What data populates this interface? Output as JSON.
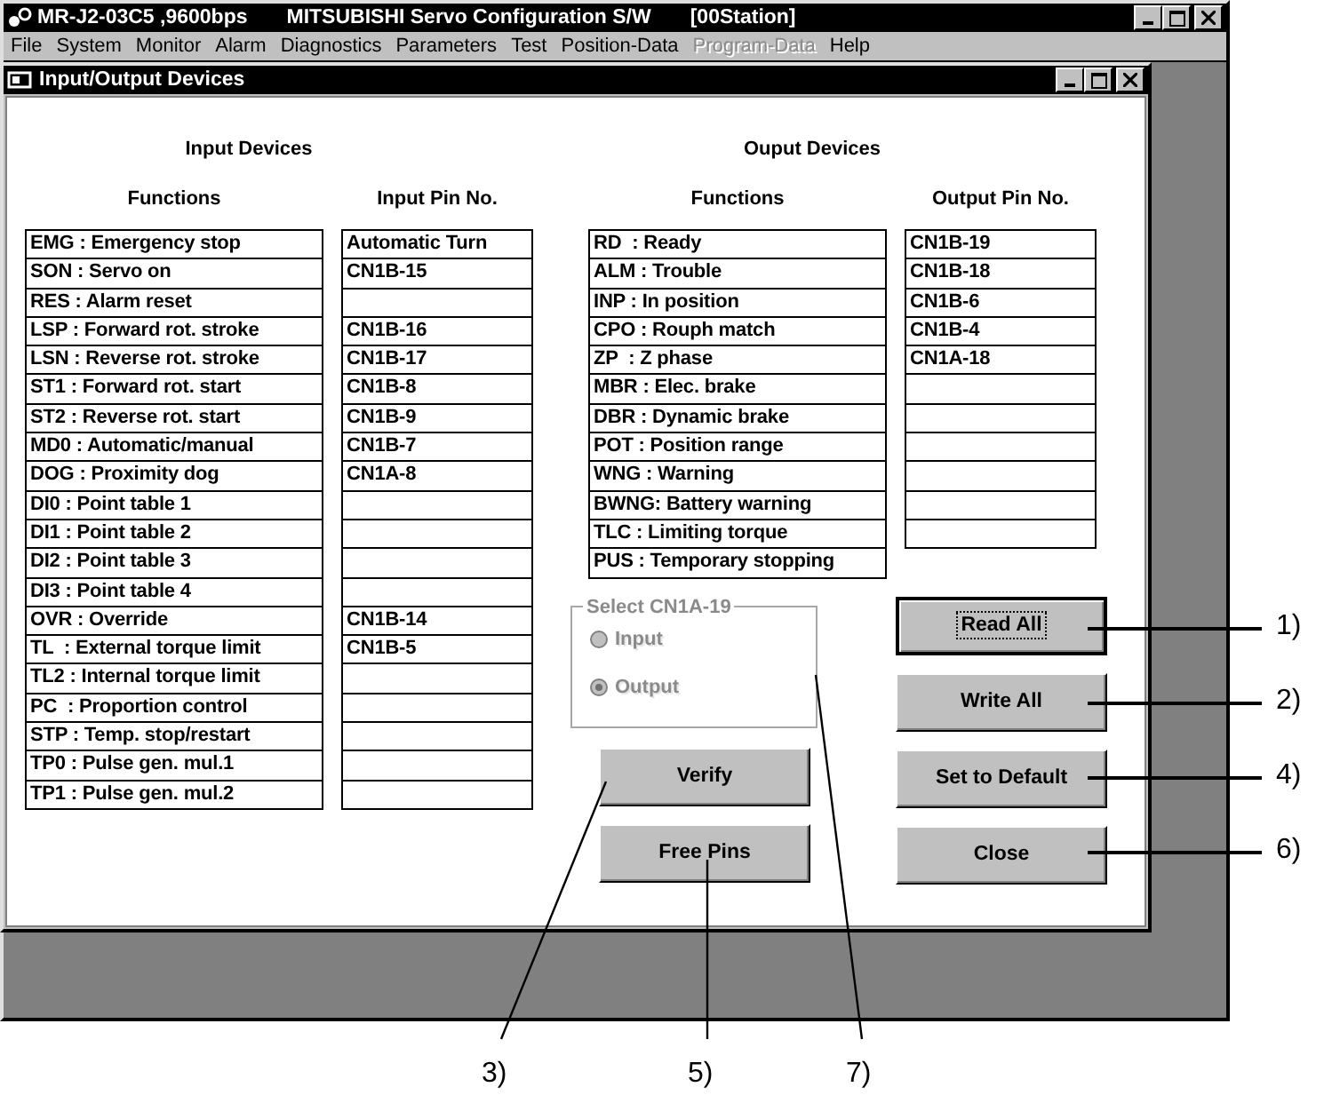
{
  "window": {
    "title_parts": [
      "MR-J2-03C5 ,9600bps",
      "MITSUBISHI Servo Configuration S/W",
      "[00Station]"
    ]
  },
  "menu": [
    {
      "label": "File",
      "disabled": false
    },
    {
      "label": "System",
      "disabled": false
    },
    {
      "label": "Monitor",
      "disabled": false
    },
    {
      "label": "Alarm",
      "disabled": false
    },
    {
      "label": "Diagnostics",
      "disabled": false
    },
    {
      "label": "Parameters",
      "disabled": false
    },
    {
      "label": "Test",
      "disabled": false
    },
    {
      "label": "Position-Data",
      "disabled": false
    },
    {
      "label": "Program-Data",
      "disabled": true
    },
    {
      "label": "Help",
      "disabled": false
    }
  ],
  "child_window": {
    "title": "Input/Output Devices"
  },
  "input_devices": {
    "heading": "Input Devices",
    "columns": [
      "Functions",
      "Input Pin No."
    ],
    "rows": [
      {
        "function": "EMG : Emergency stop",
        "pin": "Automatic Turn"
      },
      {
        "function": "SON : Servo on",
        "pin": "CN1B-15"
      },
      {
        "function": "RES : Alarm reset"
      },
      {
        "function": "LSP : Forward rot. stroke",
        "pin": "CN1B-16"
      },
      {
        "function": "LSN : Reverse rot. stroke",
        "pin": "CN1B-17"
      },
      {
        "function": "ST1 : Forward rot. start",
        "pin": "CN1B-8"
      },
      {
        "function": "ST2 : Reverse rot. start",
        "pin": "CN1B-9"
      },
      {
        "function": "MD0 : Automatic/manual",
        "pin": "CN1B-7"
      },
      {
        "function": "DOG : Proximity dog",
        "pin": "CN1A-8"
      },
      {
        "function": "DI0 : Point table 1"
      },
      {
        "function": "DI1 : Point table 2"
      },
      {
        "function": "DI2 : Point table 3"
      },
      {
        "function": "DI3 : Point table 4"
      },
      {
        "function": "OVR : Override",
        "pin": "CN1B-14"
      },
      {
        "function": "TL  : External torque limit",
        "pin": "CN1B-5"
      },
      {
        "function": "TL2 : Internal torque limit"
      },
      {
        "function": "PC  : Proportion control"
      },
      {
        "function": "STP : Temp. stop/restart"
      },
      {
        "function": "TP0 : Pulse gen. mul.1"
      },
      {
        "function": "TP1 : Pulse gen. mul.2"
      }
    ]
  },
  "output_devices": {
    "heading": "Ouput Devices",
    "columns": [
      "Functions",
      "Output Pin No."
    ],
    "rows": [
      {
        "function": "RD  : Ready",
        "pin": "CN1B-19",
        "pin_cell": true
      },
      {
        "function": "ALM : Trouble",
        "pin": "CN1B-18",
        "pin_cell": true
      },
      {
        "function": "INP : In position",
        "pin": "CN1B-6",
        "pin_cell": true
      },
      {
        "function": "CPO : Rouph match",
        "pin": "CN1B-4",
        "pin_cell": true
      },
      {
        "function": "ZP  : Z phase",
        "pin": "CN1A-18",
        "pin_cell": true
      },
      {
        "function": "MBR : Elec. brake",
        "pin_cell": true
      },
      {
        "function": "DBR : Dynamic brake",
        "pin_cell": true
      },
      {
        "function": "POT : Position range",
        "pin_cell": true
      },
      {
        "function": "WNG : Warning",
        "pin_cell": true
      },
      {
        "function": "BWNG: Battery warning",
        "pin_cell": true
      },
      {
        "function": "TLC : Limiting torque",
        "pin_cell": true
      },
      {
        "function": "PUS : Temporary stopping",
        "pin_cell": false
      }
    ]
  },
  "select_group": {
    "title": "Select CN1A-19",
    "disabled": true,
    "options": [
      {
        "label": "Input",
        "selected": false
      },
      {
        "label": "Output",
        "selected": true
      }
    ]
  },
  "left_buttons": [
    {
      "label": "Verify",
      "default": false
    },
    {
      "label": "Free Pins",
      "default": false
    }
  ],
  "right_buttons": [
    {
      "label": "Read All",
      "default": true
    },
    {
      "label": "Write All",
      "default": false
    },
    {
      "label": "Set to Default",
      "default": false
    },
    {
      "label": "Close",
      "default": false
    }
  ],
  "callouts": [
    {
      "label": "1)"
    },
    {
      "label": "2)"
    },
    {
      "label": "4)"
    },
    {
      "label": "6)"
    },
    {
      "label": "3)"
    },
    {
      "label": "5)"
    },
    {
      "label": "7)"
    }
  ]
}
